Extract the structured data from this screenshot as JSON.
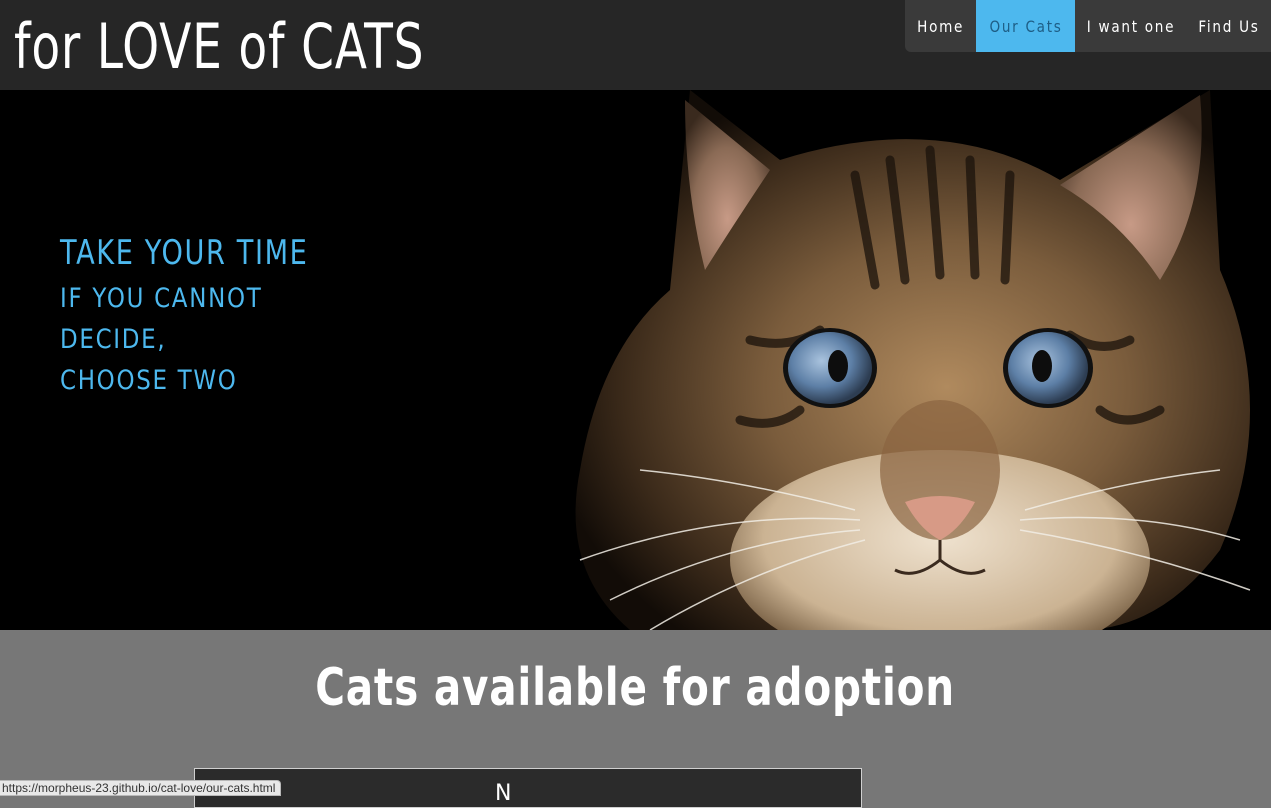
{
  "header": {
    "title": "for LOVE of CATS"
  },
  "nav": {
    "items": [
      {
        "label": "Home"
      },
      {
        "label": "Our Cats",
        "active": true
      },
      {
        "label": "I want one"
      },
      {
        "label": "Find Us"
      }
    ]
  },
  "hero": {
    "heading": "TAKE YOUR TIME",
    "subheading": "IF YOU CANNOT DECIDE, CHOOSE TWO",
    "image_alt": "tabby cat with blue eyes"
  },
  "adoption": {
    "title": "Cats available for adoption",
    "table": {
      "header_partial": "N"
    }
  },
  "status_bar": {
    "url": "https://morpheus-23.github.io/cat-love/our-cats.html"
  },
  "colors": {
    "accent": "#4db8ee",
    "header_bg": "#262626",
    "nav_bg": "#3a3a3a",
    "section_bg": "#777777",
    "hero_bg": "#000000"
  }
}
